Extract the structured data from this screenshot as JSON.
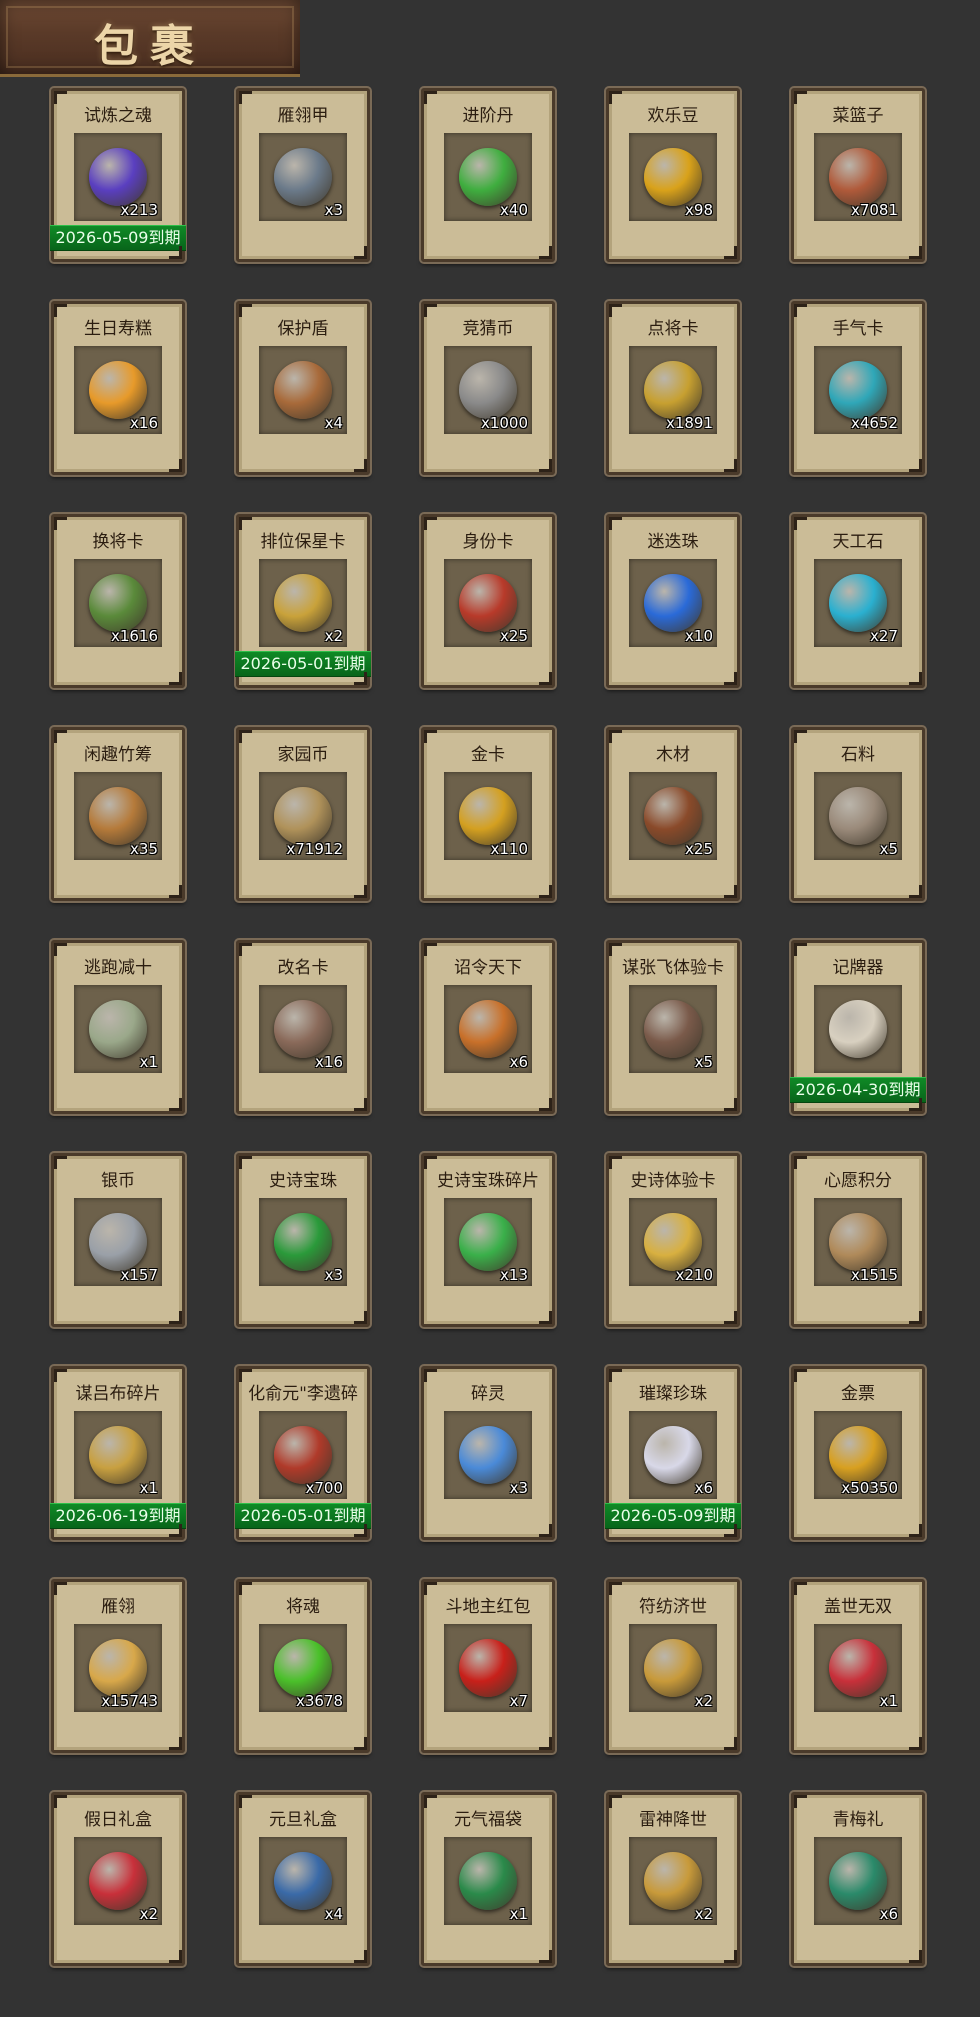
{
  "header": {
    "title": "包裹"
  },
  "items": [
    {
      "name": "试炼之魂",
      "count": "x213",
      "expiry": "2026-05-09到期",
      "icon": "purple-orb-icon",
      "color": "#5a3fc0"
    },
    {
      "name": "雁翎甲",
      "count": "x3",
      "icon": "armor-icon",
      "color": "#6b7a8a"
    },
    {
      "name": "进阶丹",
      "count": "x40",
      "icon": "green-pill-icon",
      "color": "#3fae3f"
    },
    {
      "name": "欢乐豆",
      "count": "x98",
      "icon": "gold-beans-icon",
      "color": "#d9a21a"
    },
    {
      "name": "菜篮子",
      "count": "x7081",
      "icon": "basket-icon",
      "color": "#b05a3a"
    },
    {
      "name": "生日寿糕",
      "count": "x16",
      "icon": "mooncake-icon",
      "color": "#e79a2a"
    },
    {
      "name": "保护盾",
      "count": "x4",
      "icon": "shield-icon",
      "color": "#a86a3a"
    },
    {
      "name": "竞猜币",
      "count": "x1000",
      "icon": "silver-coin-icon",
      "color": "#8a8a8a"
    },
    {
      "name": "点将卡",
      "count": "x1891",
      "icon": "general-card-icon",
      "color": "#c7a030"
    },
    {
      "name": "手气卡",
      "count": "x4652",
      "icon": "luck-card-icon",
      "color": "#2fa7b8"
    },
    {
      "name": "换将卡",
      "count": "x1616",
      "icon": "swap-card-icon",
      "color": "#5a8a3a"
    },
    {
      "name": "排位保星卡",
      "count": "x2",
      "expiry": "2026-05-01到期",
      "icon": "star-card-icon",
      "color": "#c9a23a"
    },
    {
      "name": "身份卡",
      "count": "x25",
      "icon": "mask-card-icon",
      "color": "#b83a2a"
    },
    {
      "name": "迷迭珠",
      "count": "x10",
      "icon": "blue-orb-icon",
      "color": "#2a6ad8"
    },
    {
      "name": "天工石",
      "count": "x27",
      "icon": "crystal-icon",
      "color": "#2ab0d0"
    },
    {
      "name": "闲趣竹筹",
      "count": "x35",
      "icon": "bamboo-tag-icon",
      "color": "#b57a3a"
    },
    {
      "name": "家园币",
      "count": "x71912",
      "icon": "home-coin-icon",
      "color": "#b0925a"
    },
    {
      "name": "金卡",
      "count": "x110",
      "icon": "gold-card-icon",
      "color": "#d4a020"
    },
    {
      "name": "木材",
      "count": "x25",
      "icon": "wood-icon",
      "color": "#8a4a2a"
    },
    {
      "name": "石料",
      "count": "x5",
      "icon": "stone-icon",
      "color": "#9a8a7a"
    },
    {
      "name": "逃跑减十",
      "count": "x1",
      "icon": "token-icon",
      "color": "#9aa88a"
    },
    {
      "name": "改名卡",
      "count": "x16",
      "icon": "rename-card-icon",
      "color": "#8a6a5a"
    },
    {
      "name": "诏令天下",
      "count": "x6",
      "icon": "scroll-icon",
      "color": "#c8702a"
    },
    {
      "name": "谋张飞体验卡",
      "count": "x5",
      "icon": "hero-portrait-icon",
      "color": "#7a5a4a"
    },
    {
      "name": "记牌器",
      "count": "",
      "expiry": "2026-04-30到期",
      "icon": "playing-cards-icon",
      "color": "#d8d0c0"
    },
    {
      "name": "银币",
      "count": "x157",
      "icon": "silver-coins-icon",
      "color": "#9aa0a8"
    },
    {
      "name": "史诗宝珠",
      "count": "x3",
      "icon": "green-orb-icon",
      "color": "#2a9a3a"
    },
    {
      "name": "史诗宝珠碎片",
      "count": "x13",
      "icon": "leaf-shard-icon",
      "color": "#3ab04a"
    },
    {
      "name": "史诗体验卡",
      "count": "x210",
      "icon": "trial-card-icon",
      "color": "#d8b040"
    },
    {
      "name": "心愿积分",
      "count": "x1515",
      "icon": "heart-coin-icon",
      "color": "#b08a5a"
    },
    {
      "name": "谋吕布碎片",
      "count": "x1",
      "expiry": "2026-06-19到期",
      "icon": "puzzle-piece-icon",
      "color": "#c8a040"
    },
    {
      "name": "化俞元\"李遗碎",
      "count": "x700",
      "expiry": "2026-05-01到期",
      "icon": "hero-portrait-icon",
      "color": "#b03a2a"
    },
    {
      "name": "碎灵",
      "count": "x3",
      "icon": "spirit-shard-icon",
      "color": "#4a8ad8"
    },
    {
      "name": "璀璨珍珠",
      "count": "x6",
      "expiry": "2026-05-09到期",
      "icon": "pearl-icon",
      "color": "#d8d8e8"
    },
    {
      "name": "金票",
      "count": "x50350",
      "icon": "gold-ticket-icon",
      "color": "#d8a020"
    },
    {
      "name": "雁翎",
      "count": "x15743",
      "icon": "feather-icon",
      "color": "#d8a84a"
    },
    {
      "name": "将魂",
      "count": "x3678",
      "icon": "soul-crystal-icon",
      "color": "#4ac02a"
    },
    {
      "name": "斗地主红包",
      "count": "x7",
      "icon": "red-envelope-icon",
      "color": "#c8201a"
    },
    {
      "name": "符纺济世",
      "count": "x2",
      "icon": "gift-box-icon",
      "color": "#c89a3a"
    },
    {
      "name": "盖世无双",
      "count": "x1",
      "icon": "gift-box-icon",
      "color": "#c8303a"
    },
    {
      "name": "假日礼盒",
      "count": "x2",
      "icon": "gift-box-icon",
      "color": "#c8303a"
    },
    {
      "name": "元旦礼盒",
      "count": "x4",
      "icon": "gift-box-icon",
      "color": "#3a6aa8"
    },
    {
      "name": "元气福袋",
      "count": "x1",
      "icon": "lucky-bag-icon",
      "color": "#2a8a4a"
    },
    {
      "name": "雷神降世",
      "count": "x2",
      "icon": "gift-box-icon",
      "color": "#c89a3a"
    },
    {
      "name": "青梅礼",
      "count": "x6",
      "icon": "lucky-bag-icon",
      "color": "#2a8a6a"
    }
  ]
}
